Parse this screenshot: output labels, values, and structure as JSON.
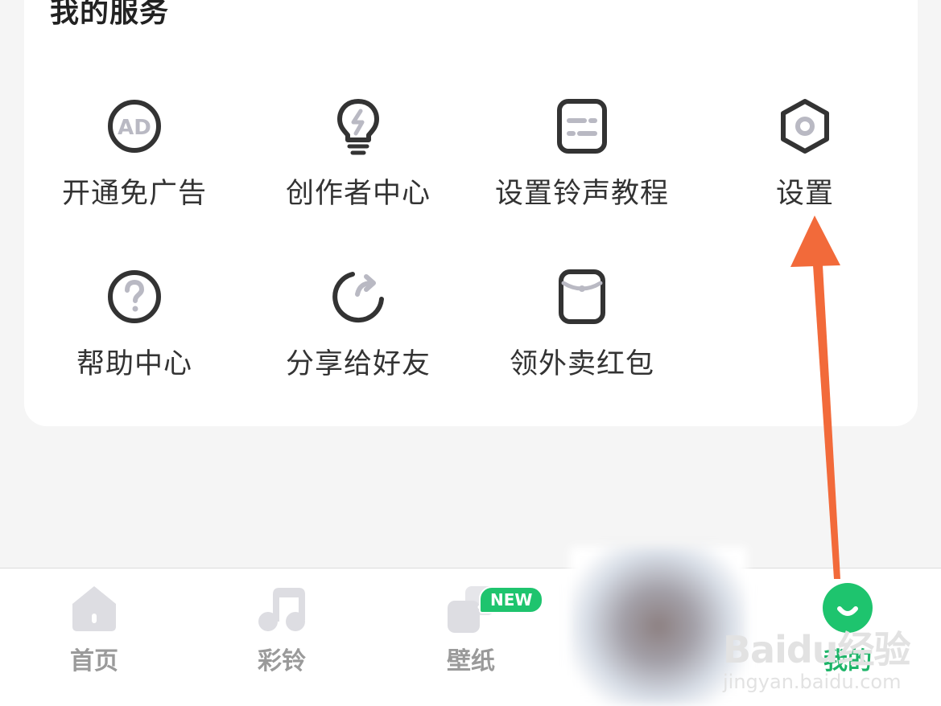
{
  "services": {
    "title": "我的服务",
    "items": [
      {
        "label": "开通免广告",
        "icon": "ad-icon"
      },
      {
        "label": "创作者中心",
        "icon": "lightbulb-icon"
      },
      {
        "label": "设置铃声教程",
        "icon": "ringtone-tutorial-icon"
      },
      {
        "label": "设置",
        "icon": "settings-hexagon-icon"
      },
      {
        "label": "帮助中心",
        "icon": "help-question-icon"
      },
      {
        "label": "分享给好友",
        "icon": "share-icon"
      },
      {
        "label": "领外卖红包",
        "icon": "red-packet-icon"
      }
    ]
  },
  "tabbar": {
    "items": [
      {
        "label": "首页",
        "icon": "home-icon"
      },
      {
        "label": "彩铃",
        "icon": "music-note-icon"
      },
      {
        "label": "壁纸",
        "icon": "wallpaper-icon",
        "badge": "NEW"
      },
      {
        "label": "我的",
        "icon": "profile-smile-icon",
        "active": true
      }
    ]
  },
  "watermark": {
    "main": "Baidu经验",
    "sub": "jingyan.baidu.com"
  },
  "colors": {
    "accent": "#1db468",
    "badge": "#1ec46e",
    "annotation_arrow": "#f26a3a",
    "icon_stroke": "#333333",
    "icon_fill": "#b9b9c3"
  }
}
